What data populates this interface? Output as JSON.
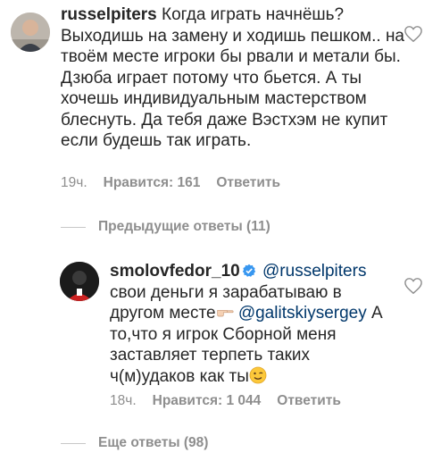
{
  "comments": [
    {
      "username": "russelpiters",
      "text": "Когда играть начнёшь? Выходишь на замену и ходишь пешком.. на твоём месте игроки бы рвали и метали бы. Дзюба играет потому что бьется. А ты хочешь индивидуальным мастерством блеснуть. Да тебя даже Вэстхэм не купит если будешь так играть.",
      "time": "19ч.",
      "likes": "Нравится: 161",
      "reply_label": "Ответить"
    },
    {
      "username": "smolovfedor_10",
      "mention1": "@russelpiters",
      "text_a": "свои деньги я зарабатываю в другом месте",
      "mention2": "@galitskiysergey",
      "text_b": "А то,что я игрок Сборной меня заставляет терпеть таких ч(м)удаков как ты",
      "time": "18ч.",
      "likes": "Нравится: 1 044",
      "reply_label": "Ответить"
    }
  ],
  "previous_replies": "Предыдущие ответы (11)",
  "more_replies": "Еще ответы (98)",
  "icons": {
    "heart": "heart-outline-icon",
    "verified": "verified-badge-icon",
    "pointing": "pointing-hand-emoji",
    "wink": "winking-face-emoji"
  },
  "colors": {
    "text": "#262626",
    "meta": "#8e8e8e",
    "mention": "#00376b",
    "verified": "#3897f0"
  }
}
